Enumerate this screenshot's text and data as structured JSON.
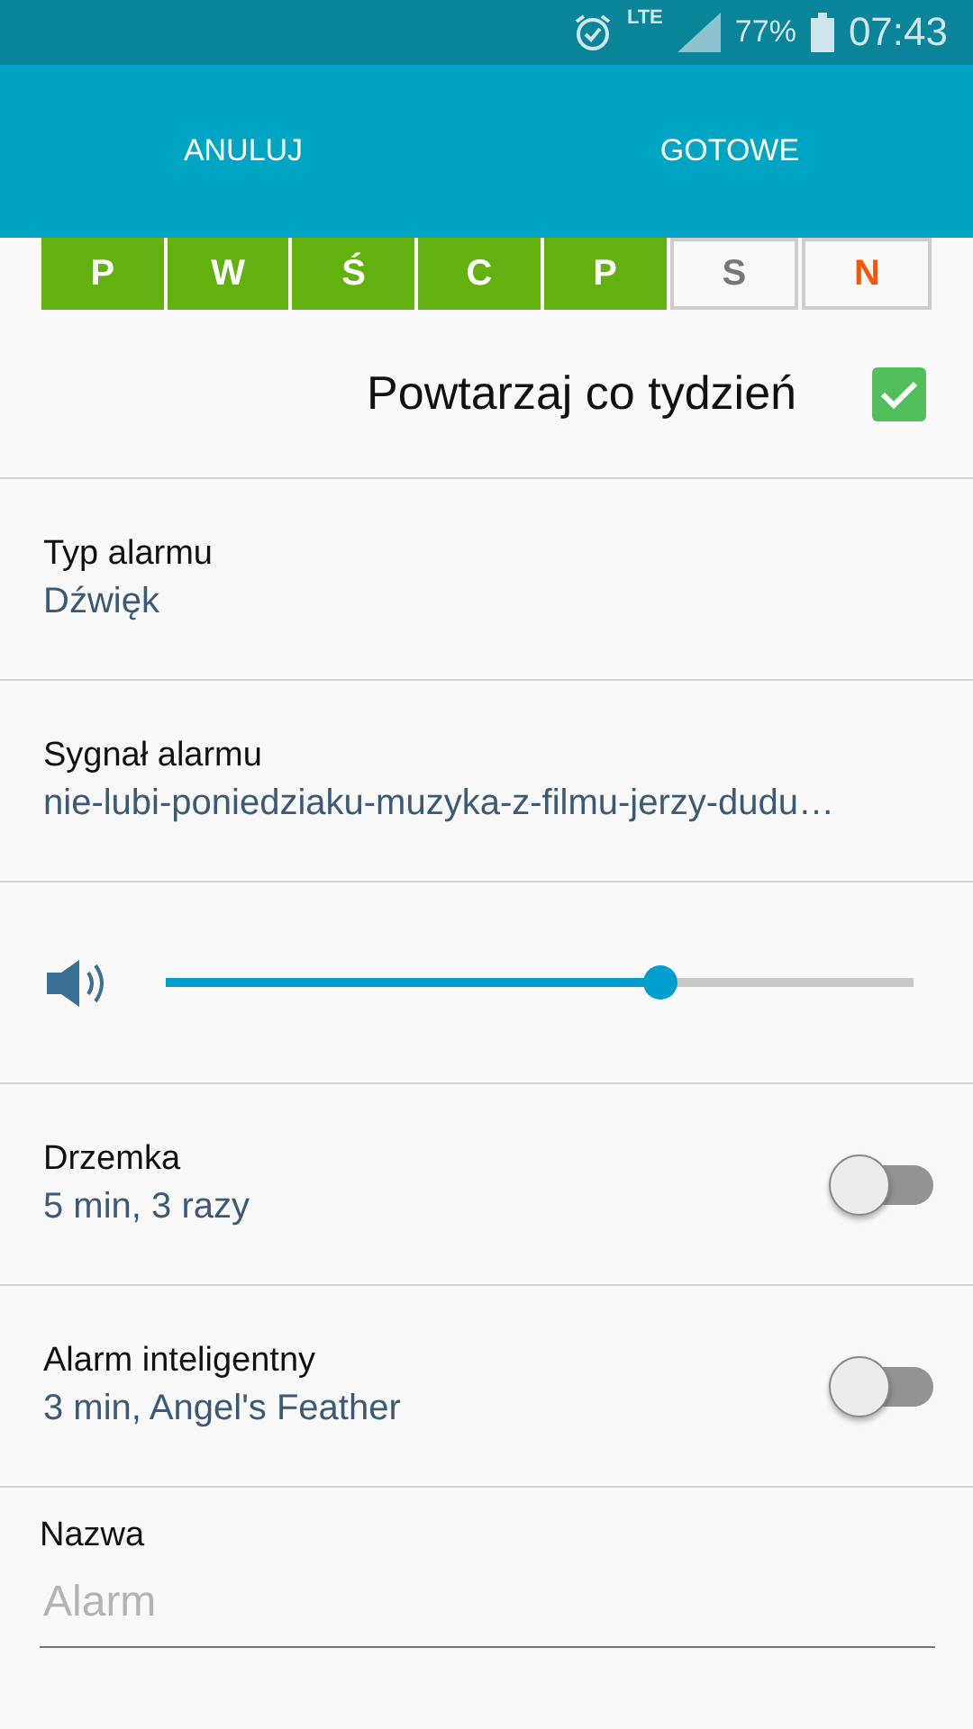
{
  "status_bar": {
    "network": "LTE",
    "battery": "77%",
    "time": "07:43"
  },
  "header": {
    "buttons": [
      "ANULUJ",
      "GOTOWE"
    ]
  },
  "days": [
    {
      "label": "P",
      "selected": true
    },
    {
      "label": "W",
      "selected": true
    },
    {
      "label": "Ś",
      "selected": true
    },
    {
      "label": "C",
      "selected": true
    },
    {
      "label": "P",
      "selected": true
    },
    {
      "label": "S",
      "selected": false,
      "color": "#777777"
    },
    {
      "label": "N",
      "selected": false,
      "color": "#ff5500"
    }
  ],
  "repeat": {
    "label": "Powtarzaj co tydzień",
    "checked": true
  },
  "settings": [
    {
      "kind": "text",
      "title": "Typ alarmu",
      "value": "Dźwięk"
    },
    {
      "kind": "text",
      "title": "Sygnał alarmu",
      "value": "nie-lubi-poniedziaku-muzyka-z-filmu-jerzy-dudu…"
    },
    {
      "kind": "volume",
      "level": 0.66
    },
    {
      "kind": "toggle",
      "title": "Drzemka",
      "value": "5 min, 3 razy",
      "on": false
    },
    {
      "kind": "toggle",
      "title": "Alarm inteligentny",
      "value": "3 min, Angel's Feather",
      "on": false
    }
  ],
  "name_field": {
    "label": "Nazwa",
    "placeholder": "Alarm"
  }
}
